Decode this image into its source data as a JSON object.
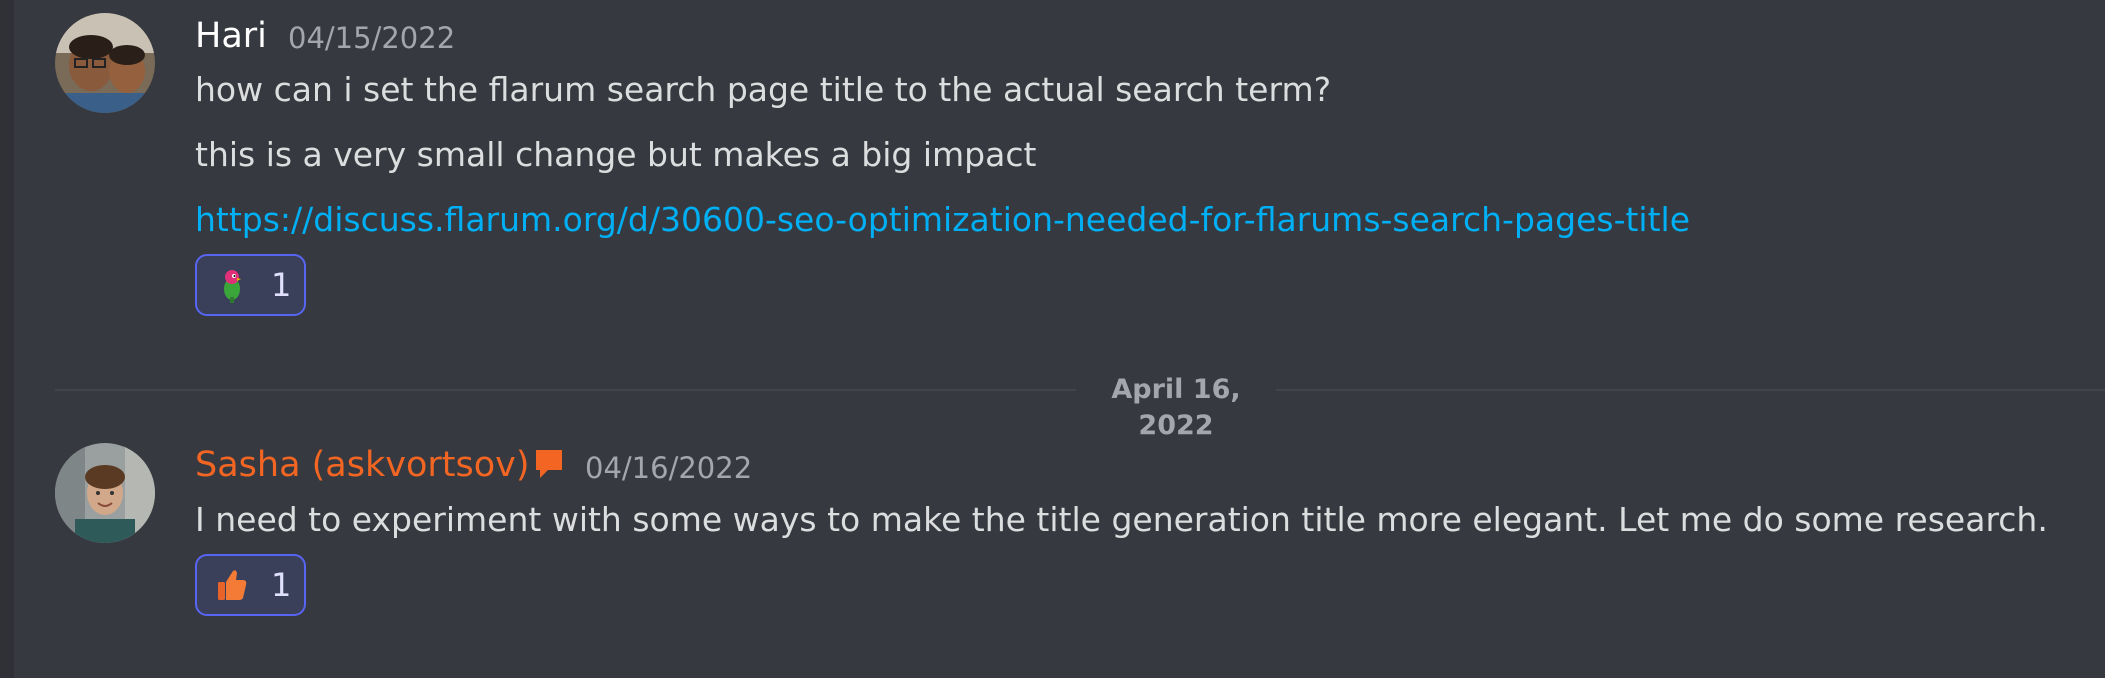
{
  "messages": [
    {
      "author": "Hari",
      "timestamp": "04/15/2022",
      "lines": [
        "how can i set the flarum search page title to the actual search term?",
        "this is a very small change but makes a big impact"
      ],
      "link": "https://discuss.flarum.org/d/30600-seo-optimization-needed-for-flarums-search-pages-title",
      "reaction": {
        "emoji": "parrot-emoji",
        "count": "1"
      }
    },
    {
      "author": "Sasha (askvortsov)",
      "author_color": "#f26522",
      "timestamp": "04/16/2022",
      "lines": [
        "I need to experiment with some ways to make the title generation title more elegant. Let me do some research."
      ],
      "reaction": {
        "emoji": "thumbs-up-emoji",
        "count": "1"
      }
    }
  ],
  "date_divider": "April 16, 2022",
  "colors": {
    "background": "#36393f",
    "reaction_border": "#5865f2",
    "link": "#00aff4"
  }
}
